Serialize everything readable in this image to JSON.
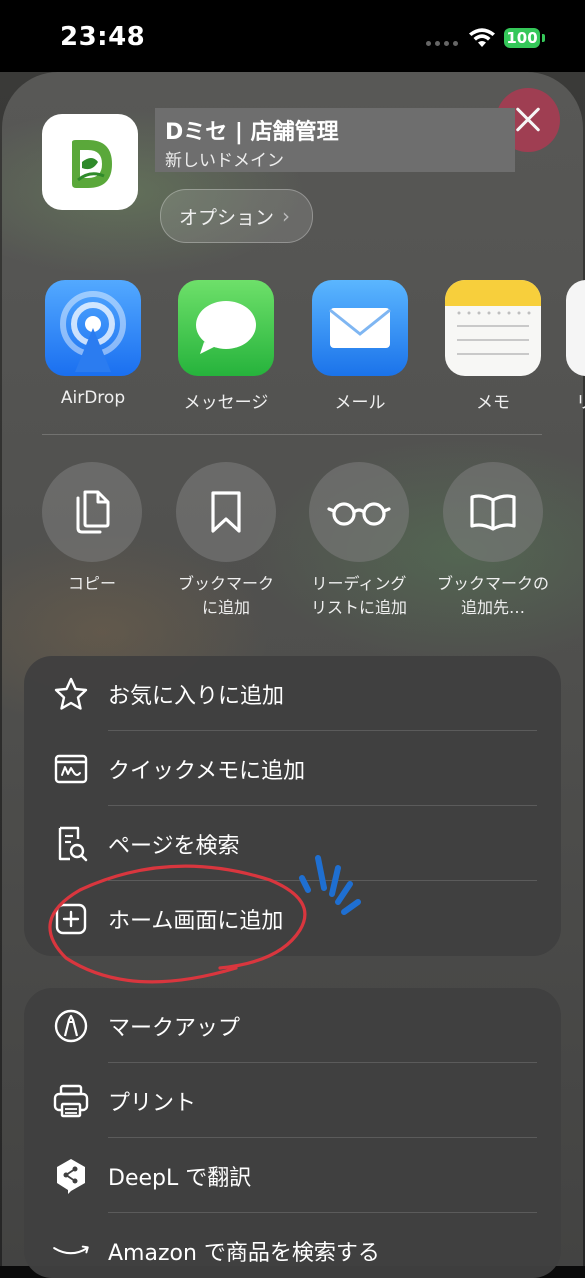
{
  "status_bar": {
    "time": "23:48",
    "battery": "100"
  },
  "app": {
    "title": "Dミセ | 店舗管理",
    "subtitle": "新しいドメイン",
    "options_label": "オプション",
    "options_chevron": "›"
  },
  "share_targets": [
    {
      "label": "AirDrop",
      "icon": "airdrop-icon"
    },
    {
      "label": "メッセージ",
      "icon": "messages-icon"
    },
    {
      "label": "メール",
      "icon": "mail-icon"
    },
    {
      "label": "メモ",
      "icon": "notes-icon"
    },
    {
      "label": "リ",
      "icon": "reminders-icon"
    }
  ],
  "actions": [
    {
      "line1": "コピー",
      "line2": "",
      "icon": "copy-icon"
    },
    {
      "line1": "ブックマーク",
      "line2": "に追加",
      "icon": "bookmark-icon"
    },
    {
      "line1": "リーディング",
      "line2": "リストに追加",
      "icon": "reading-glasses-icon"
    },
    {
      "line1": "ブックマークの",
      "line2": "追加先…",
      "icon": "book-icon"
    }
  ],
  "menu_group_1": [
    {
      "label": "お気に入りに追加",
      "icon": "star-icon"
    },
    {
      "label": "クイックメモに追加",
      "icon": "quick-note-icon"
    },
    {
      "label": "ページを検索",
      "icon": "find-page-icon"
    },
    {
      "label": "ホーム画面に追加",
      "icon": "add-square-icon"
    }
  ],
  "menu_group_2": [
    {
      "label": "マークアップ",
      "icon": "markup-icon"
    },
    {
      "label": "プリント",
      "icon": "printer-icon"
    },
    {
      "label": "DeepL で翻訳",
      "icon": "deepl-icon"
    },
    {
      "label": "Amazon で商品を検索する",
      "icon": "amazon-icon"
    }
  ],
  "colors": {
    "annotation_circle": "#d9363e",
    "annotation_sparks": "#1f6fd1",
    "close_button": "#a33d52",
    "battery": "#35c759"
  }
}
